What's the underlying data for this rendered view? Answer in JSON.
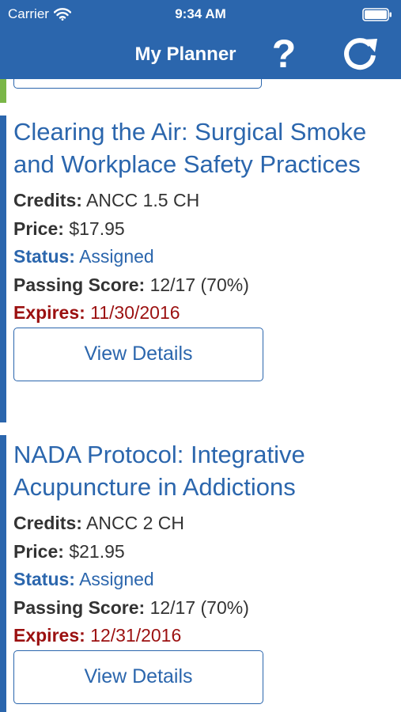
{
  "status_bar": {
    "carrier": "Carrier",
    "time": "9:34 AM",
    "wifi_icon": "wifi-icon",
    "battery_icon": "battery-icon"
  },
  "nav": {
    "title": "My Planner",
    "help_label": "?",
    "help_icon": "question-mark-icon",
    "refresh_icon": "refresh-icon"
  },
  "colors": {
    "header_bg": "#2b66ad",
    "link_blue": "#2b66ad",
    "expires_red": "#9b1010",
    "accent_green": "#7ab648",
    "accent_blue": "#2b66ad"
  },
  "courses": [
    {
      "title": "Clearing the Air: Surgical Smoke and Workplace Safety Practices",
      "credits_label": "Credits:",
      "credits": "ANCC 1.5 CH",
      "price_label": "Price:",
      "price": "$17.95",
      "status_label": "Status:",
      "status": "Assigned",
      "passing_label": "Passing Score:",
      "passing": "12/17 (70%)",
      "expires_label": "Expires:",
      "expires": "11/30/2016",
      "button": "View Details"
    },
    {
      "title": "NADA Protocol: Integrative Acupuncture in Addictions",
      "credits_label": "Credits:",
      "credits": "ANCC 2 CH",
      "price_label": "Price:",
      "price": "$21.95",
      "status_label": "Status:",
      "status": "Assigned",
      "passing_label": "Passing Score:",
      "passing": "12/17 (70%)",
      "expires_label": "Expires:",
      "expires": "12/31/2016",
      "button": "View Details"
    }
  ]
}
